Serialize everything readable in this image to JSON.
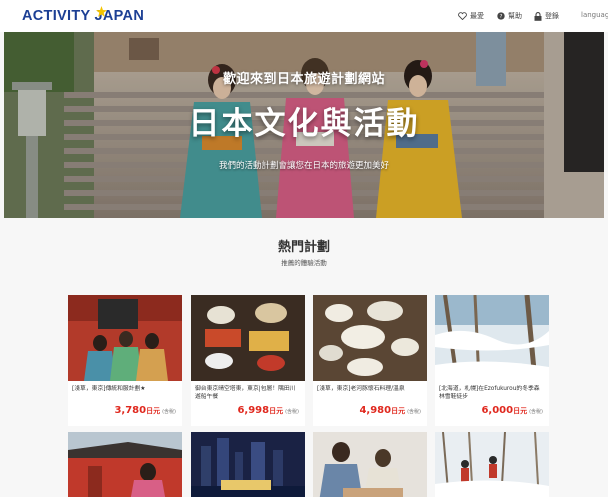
{
  "header": {
    "logo_text": "ACTIVITY JAPAN",
    "logo_accent": "#f4c400",
    "brand_color": "#1c3f94",
    "nav": [
      {
        "label": "最愛",
        "icon": "heart-icon"
      },
      {
        "label": "幫助",
        "icon": "help-circle-icon"
      },
      {
        "label": "登錄",
        "icon": "lock-icon"
      },
      {
        "label": "language",
        "icon": ""
      }
    ]
  },
  "hero": {
    "welcome": "歡迎來到日本旅遊計劃網站",
    "title": "日本文化與活動",
    "subtitle": "我們的活動計劃會讓您在日本的旅遊更加美好"
  },
  "popular": {
    "title": "熱門計劃",
    "subtitle": "推薦的體驗活動",
    "price_color": "#e0281e",
    "cards": [
      {
        "title": "[淺草，東京]傳統和服計劃★",
        "price": "3,780",
        "unit": "日元",
        "tax": "(含稅)"
      },
      {
        "title": "御台東京晴空塔東，東京|包層！隅田川遊船午餐",
        "price": "6,998",
        "unit": "日元",
        "tax": "(含稅)"
      },
      {
        "title": "[淺草，東京]老河豚懷石料理/溫泉",
        "price": "4,980",
        "unit": "日元",
        "tax": "(含稅)"
      },
      {
        "title": "[北海道，札幌]在Ezofukurou的冬季森林雪鞋徒步",
        "price": "6,000",
        "unit": "日元",
        "tax": "(含稅)"
      }
    ]
  }
}
